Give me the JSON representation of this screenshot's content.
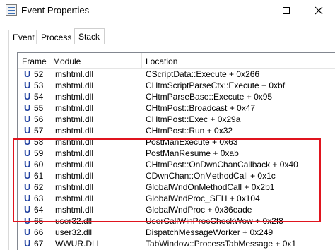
{
  "window": {
    "title": "Event Properties",
    "controls": {
      "minimize": "minimize",
      "maximize": "maximize",
      "close": "close"
    }
  },
  "tabs": [
    {
      "label": "Event",
      "selected": false
    },
    {
      "label": "Process",
      "selected": false
    },
    {
      "label": "Stack",
      "selected": true
    }
  ],
  "stack": {
    "columns": {
      "frame": "Frame",
      "module": "Module",
      "location": "Location"
    },
    "frame_icon_glyph": "U",
    "rows": [
      {
        "icon": "U",
        "frame": "52",
        "module": "mshtml.dll",
        "location": "CScriptData::Execute + 0x266"
      },
      {
        "icon": "U",
        "frame": "53",
        "module": "mshtml.dll",
        "location": "CHtmScriptParseCtx::Execute + 0xbf"
      },
      {
        "icon": "U",
        "frame": "54",
        "module": "mshtml.dll",
        "location": "CHtmParseBase::Execute + 0x95"
      },
      {
        "icon": "U",
        "frame": "55",
        "module": "mshtml.dll",
        "location": "CHtmPost::Broadcast + 0x47"
      },
      {
        "icon": "U",
        "frame": "56",
        "module": "mshtml.dll",
        "location": "CHtmPost::Exec + 0x29a"
      },
      {
        "icon": "U",
        "frame": "57",
        "module": "mshtml.dll",
        "location": "CHtmPost::Run + 0x32"
      },
      {
        "icon": "U",
        "frame": "58",
        "module": "mshtml.dll",
        "location": "PostManExecute + 0x63"
      },
      {
        "icon": "U",
        "frame": "59",
        "module": "mshtml.dll",
        "location": "PostManResume + 0xab"
      },
      {
        "icon": "U",
        "frame": "60",
        "module": "mshtml.dll",
        "location": "CHtmPost::OnDwnChanCallback + 0x40"
      },
      {
        "icon": "U",
        "frame": "61",
        "module": "mshtml.dll",
        "location": "CDwnChan::OnMethodCall + 0x1c"
      },
      {
        "icon": "U",
        "frame": "62",
        "module": "mshtml.dll",
        "location": "GlobalWndOnMethodCall + 0x2b1"
      },
      {
        "icon": "U",
        "frame": "63",
        "module": "mshtml.dll",
        "location": "GlobalWndProc_SEH + 0x104"
      },
      {
        "icon": "U",
        "frame": "64",
        "module": "mshtml.dll",
        "location": "GlobalWndProc + 0x36eade"
      },
      {
        "icon": "U",
        "frame": "65",
        "module": "user32.dll",
        "location": "UserCallWinProcCheckWow + 0x2f8"
      },
      {
        "icon": "U",
        "frame": "66",
        "module": "user32.dll",
        "location": "DispatchMessageWorker + 0x249"
      },
      {
        "icon": "U",
        "frame": "67",
        "module": "WWUR.DLL",
        "location": "TabWindow::ProcessTabMessage + 0x1"
      }
    ],
    "highlighted_frames": [
      "58",
      "59",
      "60",
      "61",
      "62",
      "63",
      "64"
    ]
  },
  "colors": {
    "highlight_border": "#e0141e",
    "frame_icon": "#1e3f9e"
  }
}
